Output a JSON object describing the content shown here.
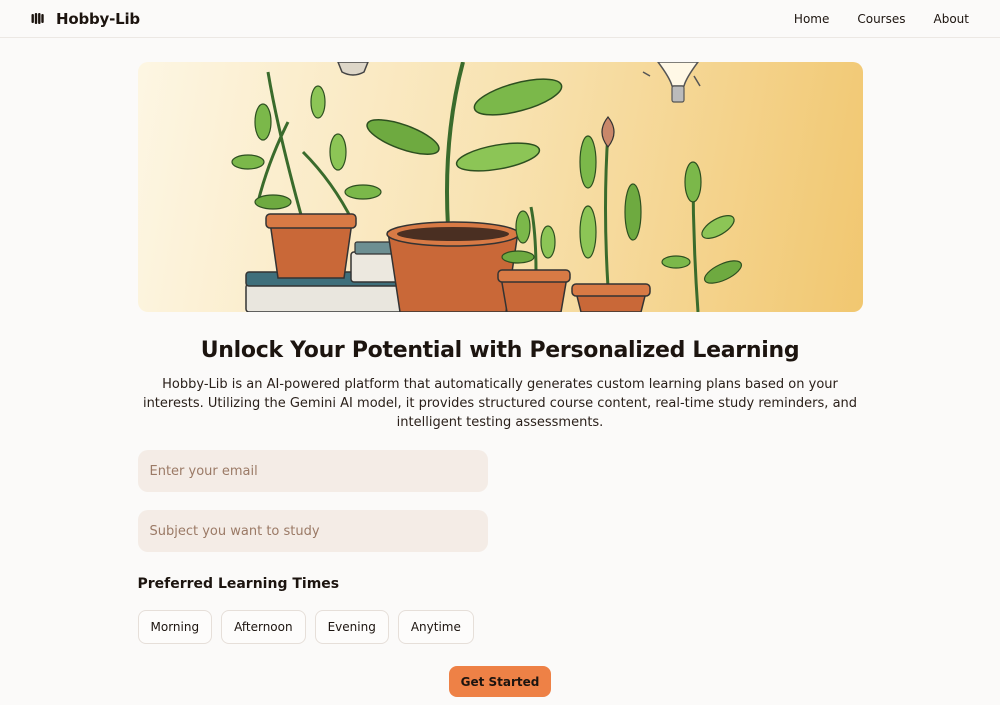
{
  "header": {
    "brand": "Hobby-Lib",
    "logo_icon": "brand-logo-icon",
    "nav": [
      {
        "label": "Home"
      },
      {
        "label": "Courses"
      },
      {
        "label": "About"
      }
    ]
  },
  "hero": {
    "image_subject": "potted-plants-books-lightbulbs-illustration"
  },
  "main": {
    "headline": "Unlock Your Potential with Personalized Learning",
    "intro": "Hobby-Lib is an AI-powered platform that automatically generates custom learning plans based on your interests. Utilizing the Gemini AI model, it provides structured course content, real-time study reminders, and intelligent testing assessments.",
    "email": {
      "value": "",
      "placeholder": "Enter your email"
    },
    "subject": {
      "value": "",
      "placeholder": "Subject you want to study"
    },
    "times_title": "Preferred Learning Times",
    "times": [
      "Morning",
      "Afternoon",
      "Evening",
      "Anytime"
    ],
    "cta_label": "Get Started"
  },
  "colors": {
    "accent": "#ee8146",
    "input_bg": "#f4ece6",
    "page_bg": "#fbfaf9"
  }
}
